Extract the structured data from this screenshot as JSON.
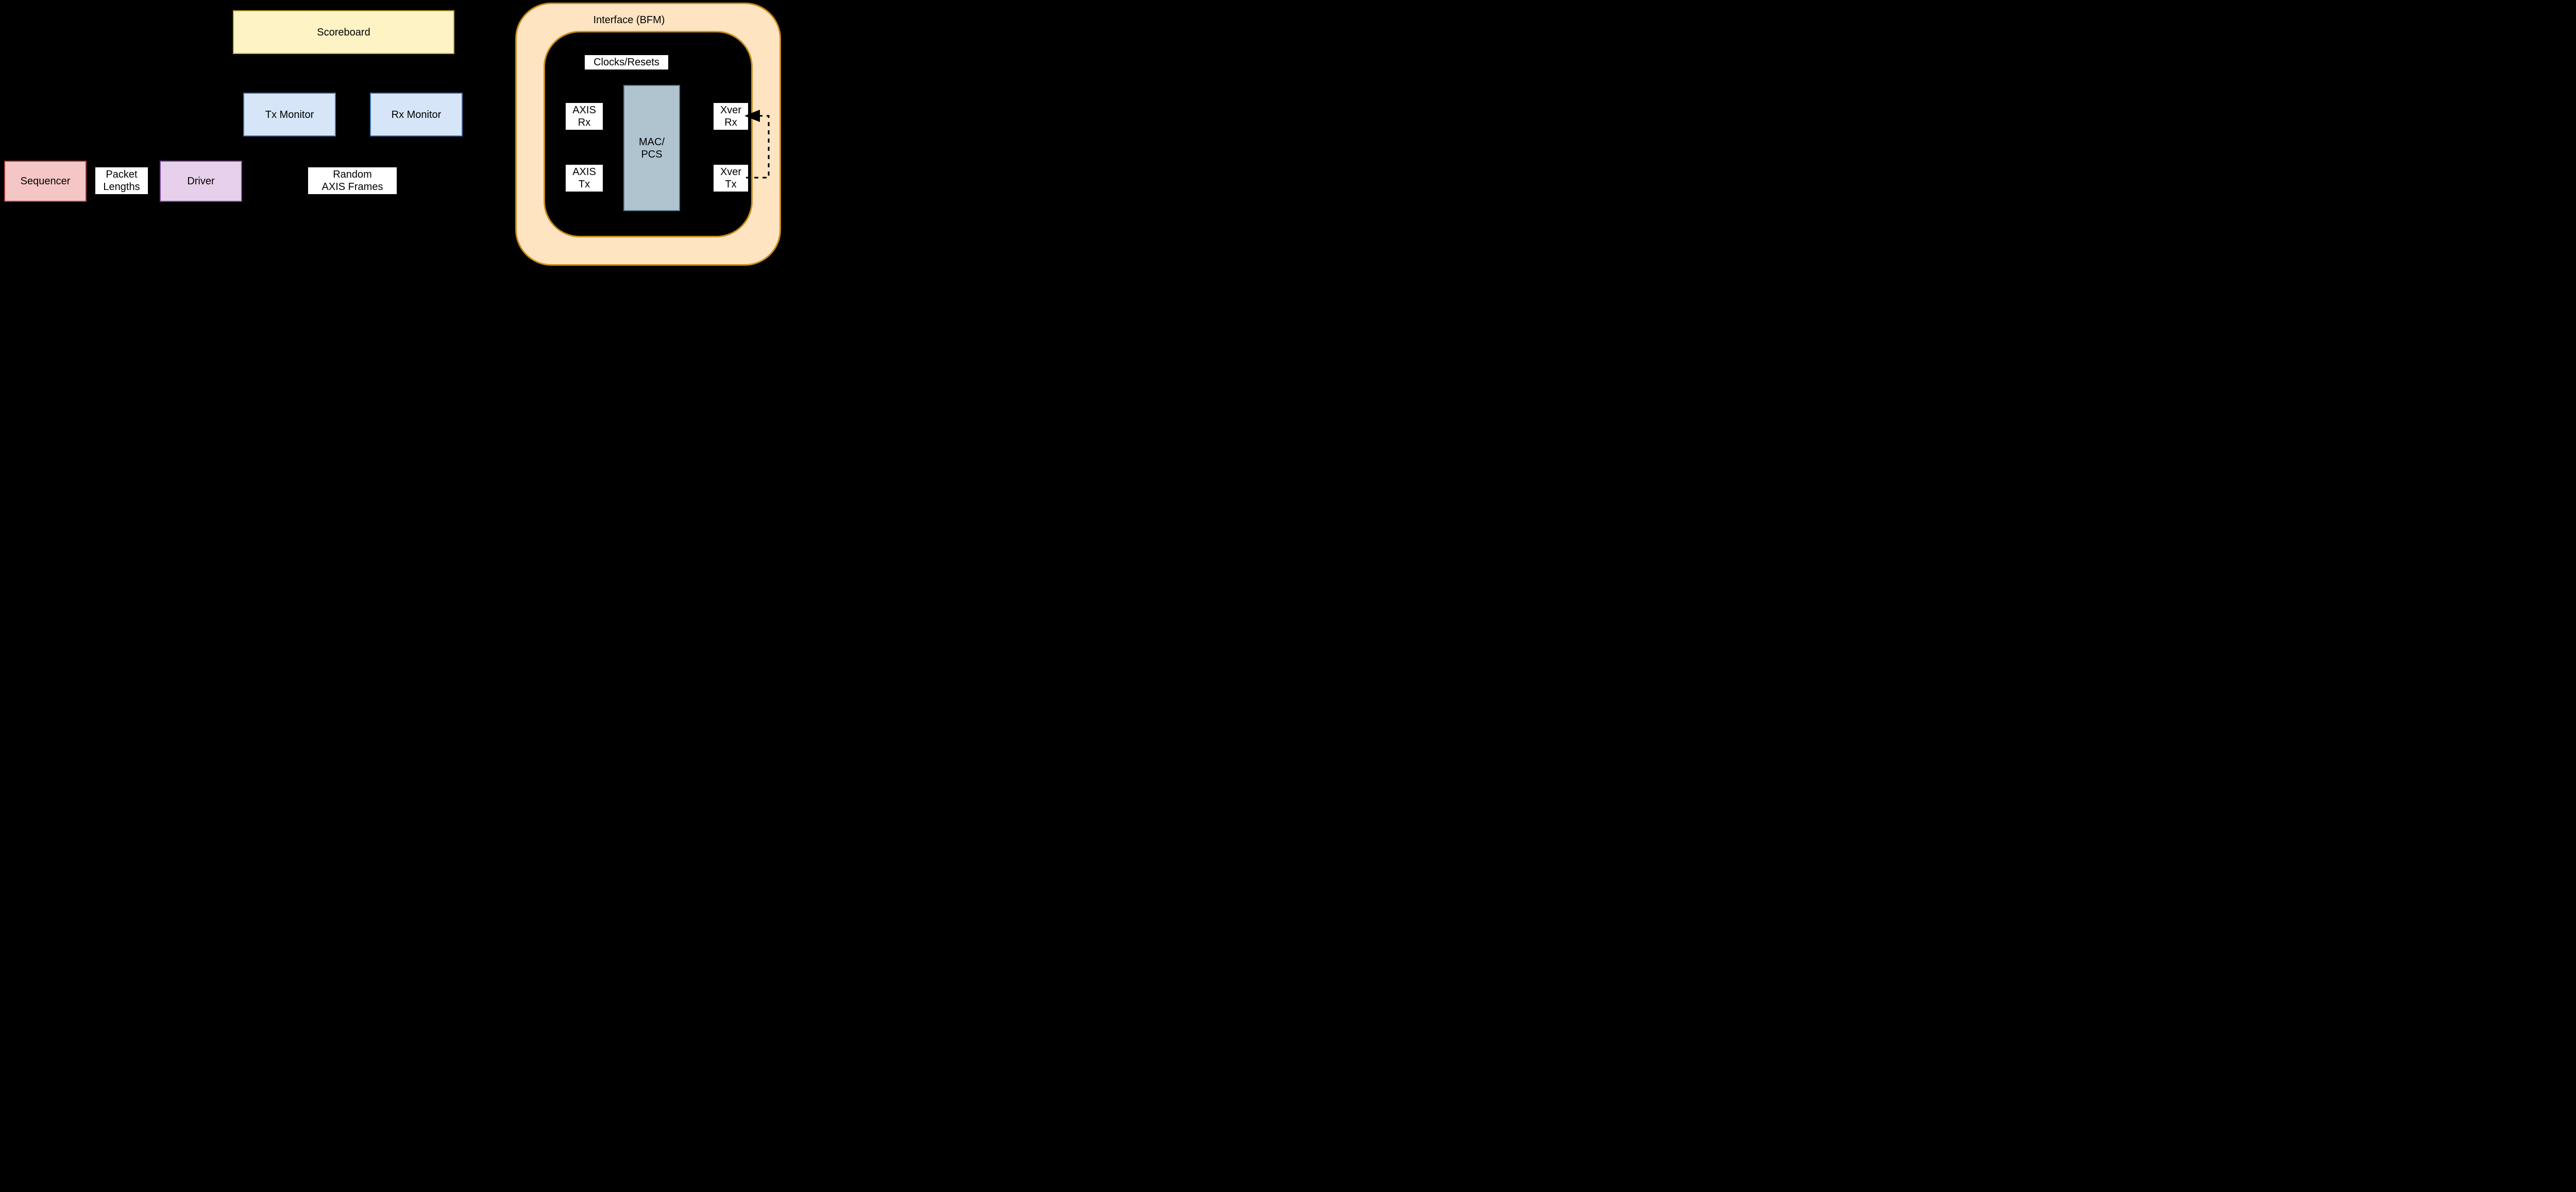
{
  "blocks": {
    "sequencer": "Sequencer",
    "driver": "Driver",
    "scoreboard": "Scoreboard",
    "tx_monitor": "Tx Monitor",
    "rx_monitor": "Rx Monitor",
    "mac_pcs": "MAC/\nPCS"
  },
  "labels": {
    "packet_lengths": "Packet\nLengths",
    "random_axis_frames": "Random\nAXIS Frames",
    "interface_bfm": "Interface (BFM)",
    "clocks_resets": "Clocks/Resets",
    "axis_rx": "AXIS\nRx",
    "axis_tx": "AXIS\nTx",
    "xver_rx": "Xver\nRx",
    "xver_tx": "Xver\nTx"
  }
}
